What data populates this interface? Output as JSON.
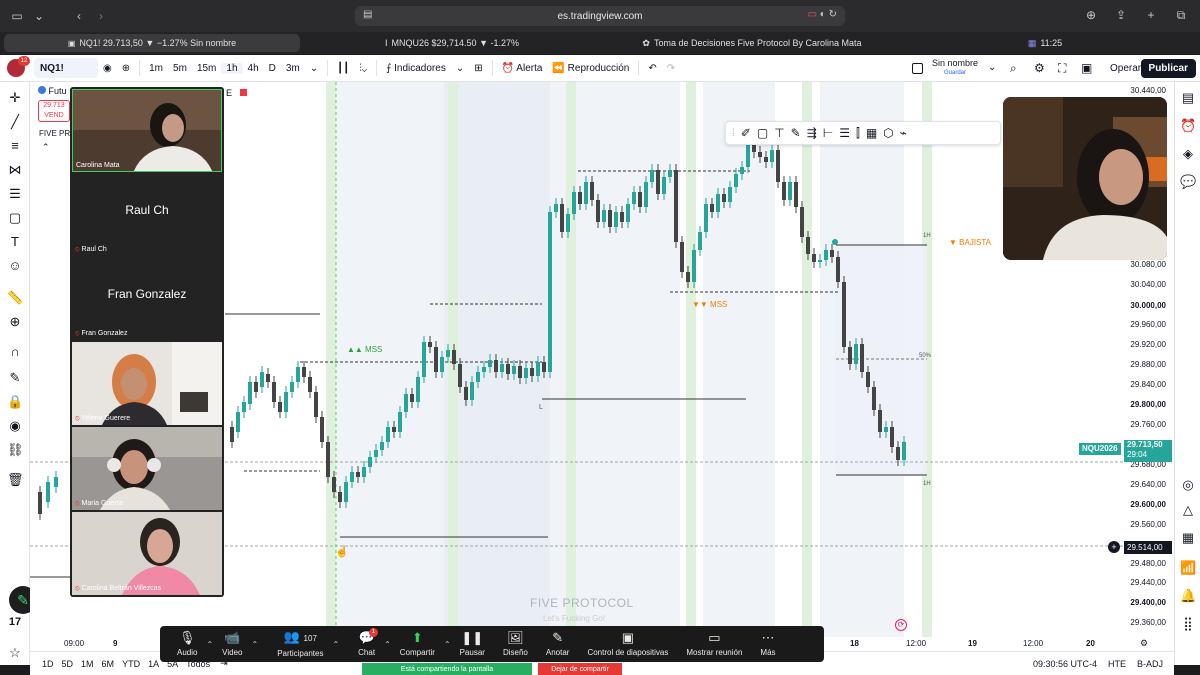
{
  "browser": {
    "url": "es.tradingview.com",
    "tabs": [
      {
        "label": "NQ1! 29.713,50 ▼ −1.27% Sin nombre",
        "active": true
      },
      {
        "label": "MNQU26 $29,714.50 ▼ -1.27%",
        "active": false
      },
      {
        "label": "Toma de Decisiones Five Protocol By Carolina Mata",
        "active": false
      },
      {
        "label": "11:25",
        "active": false
      }
    ]
  },
  "toolbar": {
    "symbol": "NQ1!",
    "notification_count": "12",
    "intervals": [
      "1m",
      "5m",
      "15m",
      "1h",
      "4h",
      "D",
      "3m"
    ],
    "indicators": "Indicadores",
    "alert": "Alerta",
    "replay": "Reproducción",
    "layout_name": "Sin nombre",
    "save_label": "Guardar",
    "trade": "Operar",
    "publish": "Publicar"
  },
  "legend": {
    "title": "Futu",
    "price": "29.713",
    "sell": "VEND",
    "indicator": "FIVE PR",
    "timeframe_suffix": "E"
  },
  "price_axis": {
    "labels": [
      "30.440,00",
      "30.080,00",
      "30.040,00",
      "30.000,00",
      "29.960,00",
      "29.920,00",
      "29.880,00",
      "29.840,00",
      "29.800,00",
      "29.760,00",
      "29.680,00",
      "29.640,00",
      "29.600,00",
      "29.560,00",
      "29.480,00",
      "29.440,00",
      "29.400,00",
      "29.360,00"
    ],
    "bold_labels": [
      "30.000,00",
      "29.800,00",
      "29.600,00",
      "29.400,00"
    ],
    "current_price": "29.713,50",
    "countdown": "29:04",
    "crosshair_price": "29.514,00",
    "symbol_tag": "NQU2026"
  },
  "time_axis": {
    "labels": [
      "09:00",
      "9",
      "18",
      "12:00",
      "19",
      "12:00",
      "20"
    ]
  },
  "bottom": {
    "ranges": [
      "1D",
      "5D",
      "1M",
      "6M",
      "YTD",
      "1A",
      "5A",
      "Todos"
    ],
    "clock": "09:30:56 UTC-4",
    "session": "HTE",
    "adj": "B-ADJ"
  },
  "annotations": {
    "mss_up": "▲▲ MSS",
    "mss_down": "▼▼ MSS",
    "bajista": "▼ BAJISTA",
    "half": "50%",
    "h1_top": "1H",
    "h1_bottom": "1H",
    "l_label": "L",
    "watermark": "FIVE PROTOCOL",
    "watermark_sub": "Let's Fucking Go!"
  },
  "participants": [
    {
      "name": "Carolina Mata",
      "video": true
    },
    {
      "name": "Raul Ch",
      "video": false
    },
    {
      "name": "Fran Gonzalez",
      "video": false
    },
    {
      "name": "Yelena Guerere",
      "video": true
    },
    {
      "name": "Maria Guerra",
      "video": true
    },
    {
      "name": "Carolina Beltrán Villezcas",
      "video": true
    }
  ],
  "zoom_toolbar": {
    "audio": "Audio",
    "video": "Video",
    "participants": "Participantes",
    "participant_count": "107",
    "chat": "Chat",
    "chat_badge": "1",
    "share": "Compartir",
    "pause": "Pausar",
    "design": "Diseño",
    "annotate": "Anotar",
    "slides": "Control de diapositivas",
    "show_meeting": "Mostrar reunión",
    "more": "Más"
  },
  "share_status": {
    "sharing": "Está compartiendo la pantalla",
    "stop": "Dejar de compartir"
  },
  "colors": {
    "bull": "#26a69a",
    "bear": "#444444",
    "session_band": "#e3e9f3",
    "green_band": "#dff0dc",
    "price_tag": "#26a69a",
    "mss": "#2e9e3a",
    "bajista": "#f57c00"
  }
}
